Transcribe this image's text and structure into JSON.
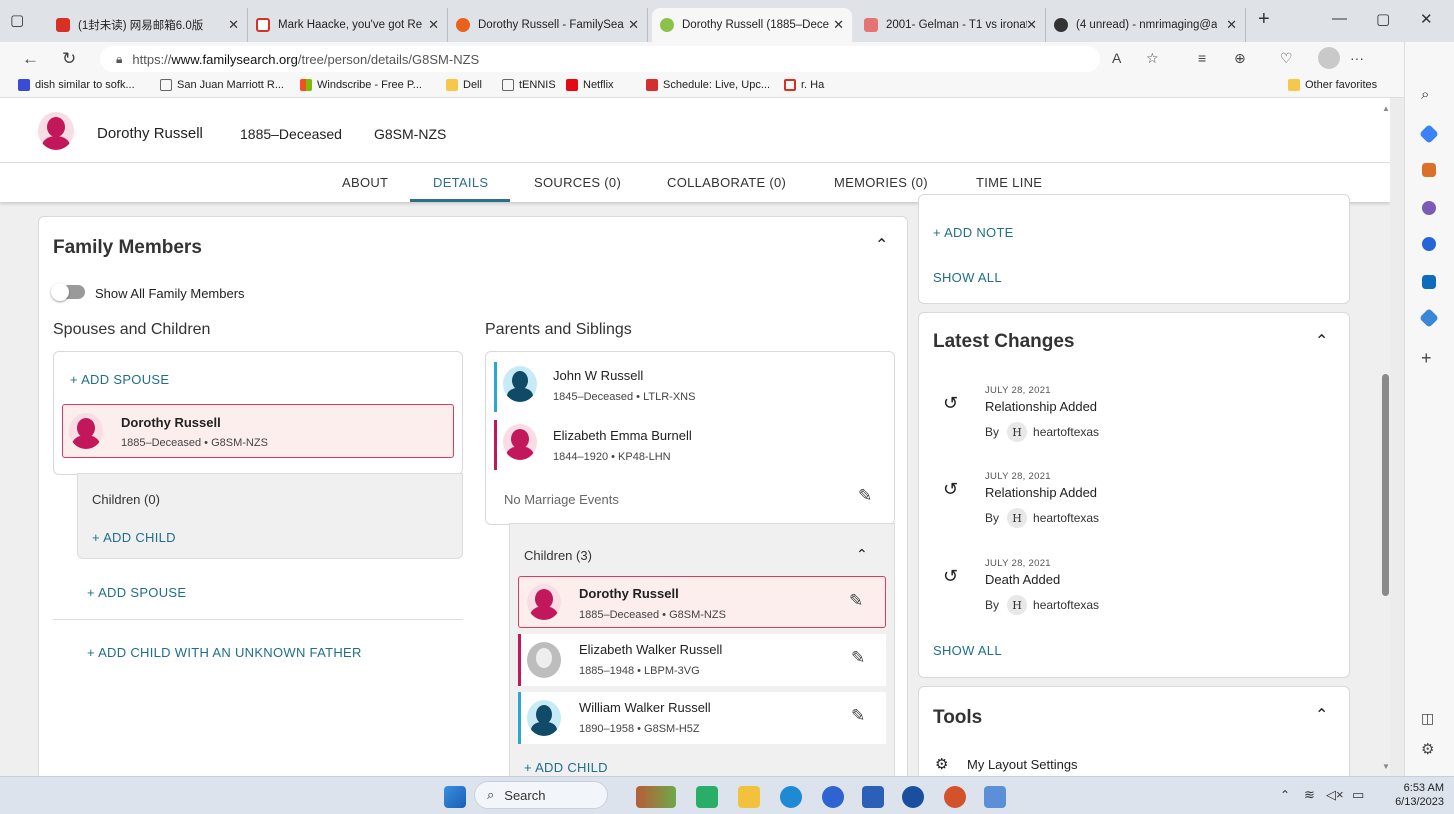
{
  "browser": {
    "tabs": [
      {
        "title": "(1封未读) 网易邮箱6.0版"
      },
      {
        "title": "Mark Haacke, you've got Re"
      },
      {
        "title": "Dorothy Russell - FamilySea"
      },
      {
        "title": "Dorothy Russell (1885–Dece"
      },
      {
        "title": "2001- Gelman - T1 vs ironat"
      },
      {
        "title": "(4 unread) - nmrimaging@a"
      }
    ],
    "url_prefix": "https://",
    "url_domain": "www.familysearch.org",
    "url_path": "/tree/person/details/G8SM-NZS",
    "bookmarks": [
      "dish similar to sofk...",
      "San Juan Marriott R...",
      "Windscribe - Free P...",
      "Dell",
      "tENNIS",
      "Netflix",
      "Schedule: Live, Upc...",
      "r. Ha"
    ],
    "other_favorites": "Other favorites",
    "colors": {
      "accent": "#1f6f8b",
      "female": "#c2185b",
      "male": "#29a9d1"
    }
  },
  "person_header": {
    "name": "Dorothy Russell",
    "lifespan": "1885–Deceased",
    "pid": "G8SM-NZS"
  },
  "nav_tabs": [
    "ABOUT",
    "DETAILS",
    "SOURCES (0)",
    "COLLABORATE (0)",
    "MEMORIES (0)",
    "TIME LINE"
  ],
  "family": {
    "title": "Family Members",
    "toggle_label": "Show All Family Members",
    "spouses_title": "Spouses and Children",
    "add_spouse": "+ ADD SPOUSE",
    "self": {
      "name": "Dorothy Russell",
      "meta": "1885–Deceased • G8SM-NZS"
    },
    "children_label": "Children (0)",
    "add_child": "+ ADD CHILD",
    "add_spouse2": "+ ADD SPOUSE",
    "add_child_unknown": "+ ADD CHILD WITH AN UNKNOWN FATHER",
    "parents_title": "Parents and Siblings",
    "father": {
      "name": "John W Russell",
      "meta": "1845–Deceased • LTLR-XNS"
    },
    "mother": {
      "name": "Elizabeth Emma Burnell",
      "meta": "1844–1920 • KP48-LHN"
    },
    "no_marriage": "No Marriage Events",
    "siblings_label": "Children (3)",
    "siblings": [
      {
        "name": "Dorothy Russell",
        "meta": "1885–Deceased • G8SM-NZS"
      },
      {
        "name": "Elizabeth Walker Russell",
        "meta": "1885–1948 • LBPM-3VG"
      },
      {
        "name": "William Walker Russell",
        "meta": "1890–1958 • G8SM-H5Z"
      }
    ],
    "add_child_sib": "+ ADD CHILD"
  },
  "notes": {
    "add_note": "+ ADD NOTE",
    "show_all": "SHOW ALL"
  },
  "latest_changes": {
    "title": "Latest Changes",
    "items": [
      {
        "date": "JULY 28, 2021",
        "event": "Relationship Added",
        "by": "By",
        "initial": "H",
        "user": "heartoftexas"
      },
      {
        "date": "JULY 28, 2021",
        "event": "Relationship Added",
        "by": "By",
        "initial": "H",
        "user": "heartoftexas"
      },
      {
        "date": "JULY 28, 2021",
        "event": "Death Added",
        "by": "By",
        "initial": "H",
        "user": "heartoftexas"
      }
    ],
    "show_all": "SHOW ALL"
  },
  "tools": {
    "title": "Tools",
    "layout_settings": "My Layout Settings"
  },
  "taskbar": {
    "search": "Search",
    "time": "6:53 AM",
    "date": "6/13/2023"
  }
}
